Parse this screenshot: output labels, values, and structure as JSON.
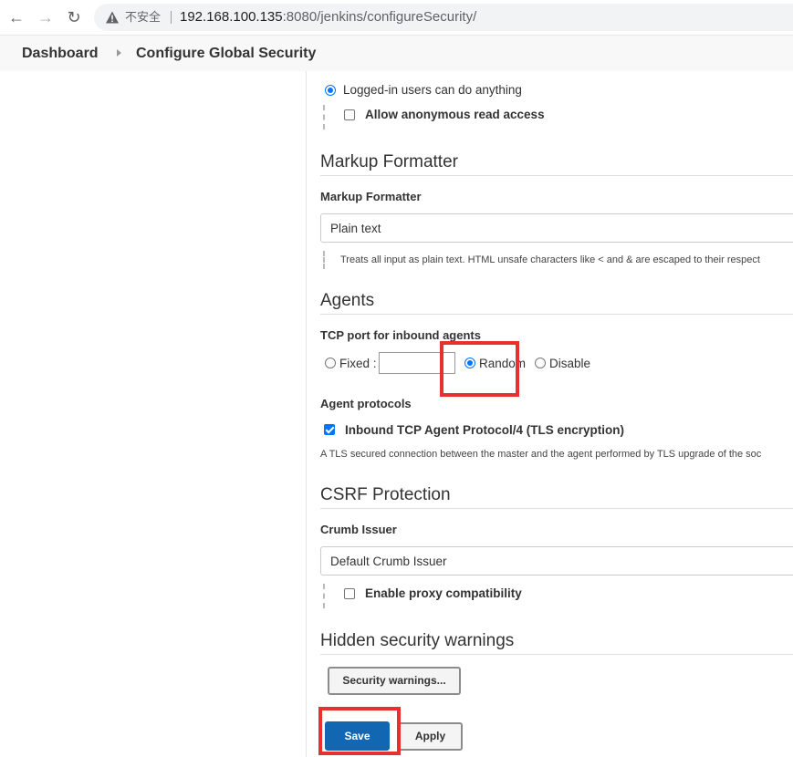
{
  "browser": {
    "security_label": "不安全",
    "url_host": "192.168.100.135",
    "url_path": ":8080/jenkins/configureSecurity/"
  },
  "breadcrumb": {
    "items": [
      "Dashboard",
      "Configure Global Security"
    ]
  },
  "authorization": {
    "selected_option": "Logged-in users can do anything",
    "anonymous_read_label": "Allow anonymous read access",
    "anonymous_read_checked": false
  },
  "markup_formatter": {
    "section_title": "Markup Formatter",
    "field_label": "Markup Formatter",
    "selected_value": "Plain text",
    "help": "Treats all input as plain text. HTML unsafe characters like < and & are escaped to their respect"
  },
  "agents": {
    "section_title": "Agents",
    "tcp_port_label": "TCP port for inbound agents",
    "options": [
      "Fixed :",
      "Random",
      "Disable"
    ],
    "selected_option": "Random",
    "fixed_port_value": "",
    "protocols_label": "Agent protocols",
    "protocol_name": "Inbound TCP Agent Protocol/4 (TLS encryption)",
    "protocol_checked": true,
    "protocol_help": "A TLS secured connection between the master and the agent performed by TLS upgrade of the soc"
  },
  "csrf": {
    "section_title": "CSRF Protection",
    "field_label": "Crumb Issuer",
    "selected_value": "Default Crumb Issuer",
    "proxy_label": "Enable proxy compatibility",
    "proxy_checked": false
  },
  "hidden_warnings": {
    "section_title": "Hidden security warnings",
    "button_label": "Security warnings..."
  },
  "actions": {
    "save_label": "Save",
    "apply_label": "Apply"
  },
  "colors": {
    "accent": "#0075ff",
    "save_button": "#1167b1",
    "highlight": "#e8302f"
  }
}
